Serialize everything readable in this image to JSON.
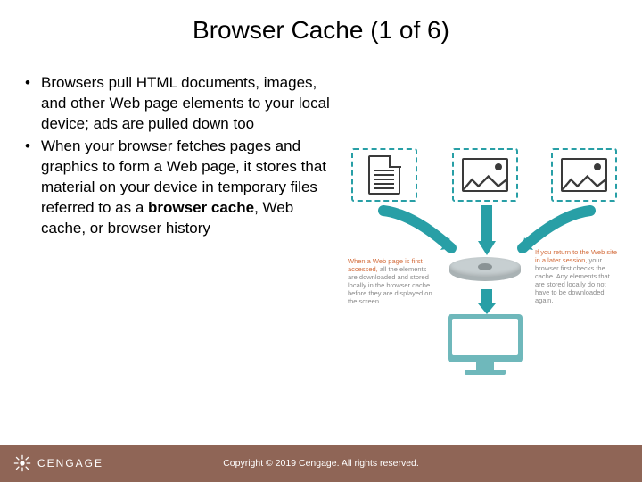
{
  "title": "Browser Cache (1 of 6)",
  "bullets": [
    {
      "text": "Browsers pull HTML documents, images, and other Web page elements to your local device; ads are pulled down too"
    },
    {
      "html": "When your browser fetches pages and graphics to form a Web page, it stores that material on your device in temporary files referred to as a <b>browser cache</b>, Web cache, or browser history"
    }
  ],
  "diagram": {
    "caption1_lead": "When a Web page is first accessed,",
    "caption1_rest": " all the elements are downloaded and stored locally in the browser cache before they are displayed on the screen.",
    "caption2_lead": "If you return to the Web site in a later session,",
    "caption2_rest": " your browser first checks the cache. Any elements that are stored locally do not have to be downloaded again."
  },
  "footer": {
    "brand": "CENGAGE",
    "copyright": "Copyright © 2019 Cengage. All rights reserved."
  }
}
